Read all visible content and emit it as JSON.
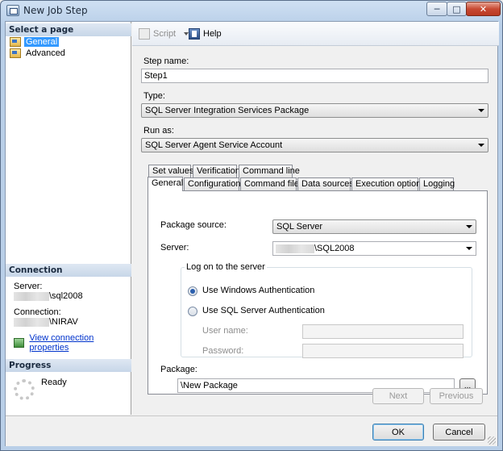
{
  "window": {
    "title": "New Job Step",
    "minimize": "─",
    "maximize": "□",
    "close": "✕"
  },
  "left": {
    "select_page_header": "Select a page",
    "pages": [
      {
        "label": "General",
        "icon": "page-icon"
      },
      {
        "label": "Advanced",
        "icon": "page-icon"
      }
    ],
    "connection_header": "Connection",
    "server_label": "Server:",
    "server_value": "\\sql2008",
    "connection_label": "Connection:",
    "connection_value": "\\NIRAV",
    "view_connection_link": "View connection properties",
    "progress_header": "Progress",
    "progress_status": "Ready"
  },
  "toolbar": {
    "script_label": "Script",
    "help_label": "Help"
  },
  "form": {
    "step_name_label": "Step name:",
    "step_name_value": "Step1",
    "type_label": "Type:",
    "type_value": "SQL Server Integration Services Package",
    "run_as_label": "Run as:",
    "run_as_value": "SQL Server Agent Service Account"
  },
  "tabs_row1": [
    "Set values",
    "Verification",
    "Command line"
  ],
  "tabs_row2": [
    "General",
    "Configurations",
    "Command files",
    "Data sources",
    "Execution options",
    "Logging"
  ],
  "panel": {
    "package_source_label": "Package source:",
    "package_source_value": "SQL Server",
    "server_label": "Server:",
    "server_value": "\\SQL2008",
    "logon_group_title": "Log on to the server",
    "windows_auth_label": "Use Windows Authentication",
    "sql_auth_label": "Use SQL Server Authentication",
    "username_label": "User name:",
    "password_label": "Password:",
    "package_label": "Package:",
    "package_value": "\\New Package",
    "browse_label": "..."
  },
  "nav": {
    "next_label": "Next",
    "previous_label": "Previous"
  },
  "footer": {
    "ok_label": "OK",
    "cancel_label": "Cancel"
  }
}
